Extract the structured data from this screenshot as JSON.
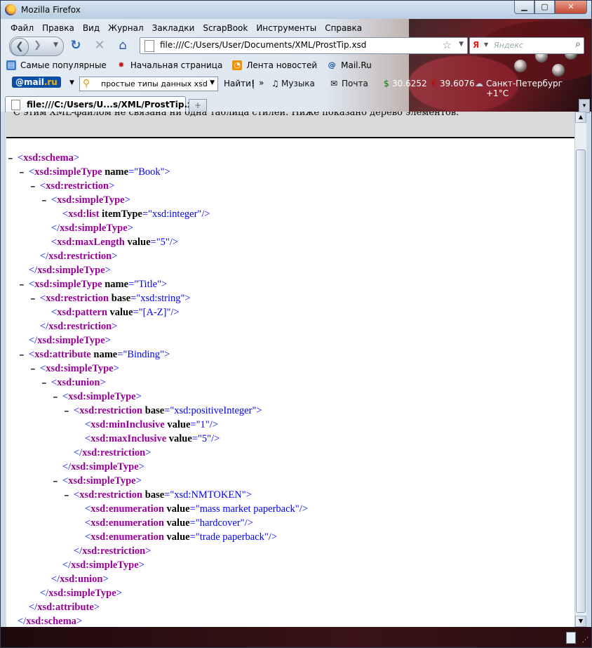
{
  "window": {
    "title": "Mozilla Firefox"
  },
  "menu": [
    "Файл",
    "Правка",
    "Вид",
    "Журнал",
    "Закладки",
    "ScrapBook",
    "Инструменты",
    "Справка"
  ],
  "nav": {
    "url": "file:///C:/Users/User/Documents/XML/ProstTip.xsd",
    "search_placeholder": "Яндекс",
    "search_engine": "Я"
  },
  "bookmarks": [
    "Самые популярные",
    "Начальная страница",
    "Лента новостей",
    "Mail.Ru"
  ],
  "mailbar": {
    "logo_at": "@mail",
    "logo_ru": ".ru",
    "search_value": "простые типы данных xsd",
    "find_label": "Найти!",
    "more": "»",
    "music": "Музыка",
    "mail": "Почта",
    "rate1": "30.6252",
    "rate2": "39.6076",
    "weather": "Санкт-Петербург +1°C"
  },
  "tab": {
    "label": "file:///C:/Users/U...s/XML/ProstTip.xsd",
    "new_tab": "+"
  },
  "infobar": {
    "message": "С этим XML-файлом не связана ни одна таблица стилей. Ниже показано дерево элементов."
  },
  "xml_lines": [
    {
      "indent": 0,
      "minus": true,
      "tag": "xsd:schema",
      "attrs": [],
      "close": false,
      "self": false
    },
    {
      "indent": 1,
      "minus": true,
      "tag": "xsd:simpleType",
      "attrs": [
        [
          "name",
          "Book"
        ]
      ],
      "close": false,
      "self": false
    },
    {
      "indent": 2,
      "minus": true,
      "tag": "xsd:restriction",
      "attrs": [],
      "close": false,
      "self": false
    },
    {
      "indent": 3,
      "minus": true,
      "tag": "xsd:simpleType",
      "attrs": [],
      "close": false,
      "self": false
    },
    {
      "indent": 4,
      "minus": false,
      "tag": "xsd:list",
      "attrs": [
        [
          "itemType",
          "xsd:integer"
        ]
      ],
      "close": false,
      "self": true
    },
    {
      "indent": 3,
      "minus": false,
      "tag": "xsd:simpleType",
      "attrs": [],
      "close": true,
      "self": false
    },
    {
      "indent": 3,
      "minus": false,
      "tag": "xsd:maxLength",
      "attrs": [
        [
          "value",
          "5"
        ]
      ],
      "close": false,
      "self": true
    },
    {
      "indent": 2,
      "minus": false,
      "tag": "xsd:restriction",
      "attrs": [],
      "close": true,
      "self": false
    },
    {
      "indent": 1,
      "minus": false,
      "tag": "xsd:simpleType",
      "attrs": [],
      "close": true,
      "self": false
    },
    {
      "indent": 1,
      "minus": true,
      "tag": "xsd:simpleType",
      "attrs": [
        [
          "name",
          "Title"
        ]
      ],
      "close": false,
      "self": false
    },
    {
      "indent": 2,
      "minus": true,
      "tag": "xsd:restriction",
      "attrs": [
        [
          "base",
          "xsd:string"
        ]
      ],
      "close": false,
      "self": false
    },
    {
      "indent": 3,
      "minus": false,
      "tag": "xsd:pattern",
      "attrs": [
        [
          "value",
          "[A-Z]"
        ]
      ],
      "close": false,
      "self": true
    },
    {
      "indent": 2,
      "minus": false,
      "tag": "xsd:restriction",
      "attrs": [],
      "close": true,
      "self": false
    },
    {
      "indent": 1,
      "minus": false,
      "tag": "xsd:simpleType",
      "attrs": [],
      "close": true,
      "self": false
    },
    {
      "indent": 1,
      "minus": true,
      "tag": "xsd:attribute",
      "attrs": [
        [
          "name",
          "Binding"
        ]
      ],
      "close": false,
      "self": false
    },
    {
      "indent": 2,
      "minus": true,
      "tag": "xsd:simpleType",
      "attrs": [],
      "close": false,
      "self": false
    },
    {
      "indent": 3,
      "minus": true,
      "tag": "xsd:union",
      "attrs": [],
      "close": false,
      "self": false
    },
    {
      "indent": 4,
      "minus": true,
      "tag": "xsd:simpleType",
      "attrs": [],
      "close": false,
      "self": false
    },
    {
      "indent": 5,
      "minus": true,
      "tag": "xsd:restriction",
      "attrs": [
        [
          "base",
          "xsd:positiveInteger"
        ]
      ],
      "close": false,
      "self": false
    },
    {
      "indent": 6,
      "minus": false,
      "tag": "xsd:minInclusive",
      "attrs": [
        [
          "value",
          "1"
        ]
      ],
      "close": false,
      "self": true
    },
    {
      "indent": 6,
      "minus": false,
      "tag": "xsd:maxInclusive",
      "attrs": [
        [
          "value",
          "5"
        ]
      ],
      "close": false,
      "self": true
    },
    {
      "indent": 5,
      "minus": false,
      "tag": "xsd:restriction",
      "attrs": [],
      "close": true,
      "self": false
    },
    {
      "indent": 4,
      "minus": false,
      "tag": "xsd:simpleType",
      "attrs": [],
      "close": true,
      "self": false
    },
    {
      "indent": 4,
      "minus": true,
      "tag": "xsd:simpleType",
      "attrs": [],
      "close": false,
      "self": false
    },
    {
      "indent": 5,
      "minus": true,
      "tag": "xsd:restriction",
      "attrs": [
        [
          "base",
          "xsd:NMTOKEN"
        ]
      ],
      "close": false,
      "self": false
    },
    {
      "indent": 6,
      "minus": false,
      "tag": "xsd:enumeration",
      "attrs": [
        [
          "value",
          "mass market paperback"
        ]
      ],
      "close": false,
      "self": true
    },
    {
      "indent": 6,
      "minus": false,
      "tag": "xsd:enumeration",
      "attrs": [
        [
          "value",
          "hardcover"
        ]
      ],
      "close": false,
      "self": true
    },
    {
      "indent": 6,
      "minus": false,
      "tag": "xsd:enumeration",
      "attrs": [
        [
          "value",
          "trade paperback"
        ]
      ],
      "close": false,
      "self": true
    },
    {
      "indent": 5,
      "minus": false,
      "tag": "xsd:restriction",
      "attrs": [],
      "close": true,
      "self": false
    },
    {
      "indent": 4,
      "minus": false,
      "tag": "xsd:simpleType",
      "attrs": [],
      "close": true,
      "self": false
    },
    {
      "indent": 3,
      "minus": false,
      "tag": "xsd:union",
      "attrs": [],
      "close": true,
      "self": false
    },
    {
      "indent": 2,
      "minus": false,
      "tag": "xsd:simpleType",
      "attrs": [],
      "close": true,
      "self": false
    },
    {
      "indent": 1,
      "minus": false,
      "tag": "xsd:attribute",
      "attrs": [],
      "close": true,
      "self": false
    },
    {
      "indent": 0,
      "minus": false,
      "tag": "xsd:schema",
      "attrs": [],
      "close": true,
      "self": false
    }
  ]
}
